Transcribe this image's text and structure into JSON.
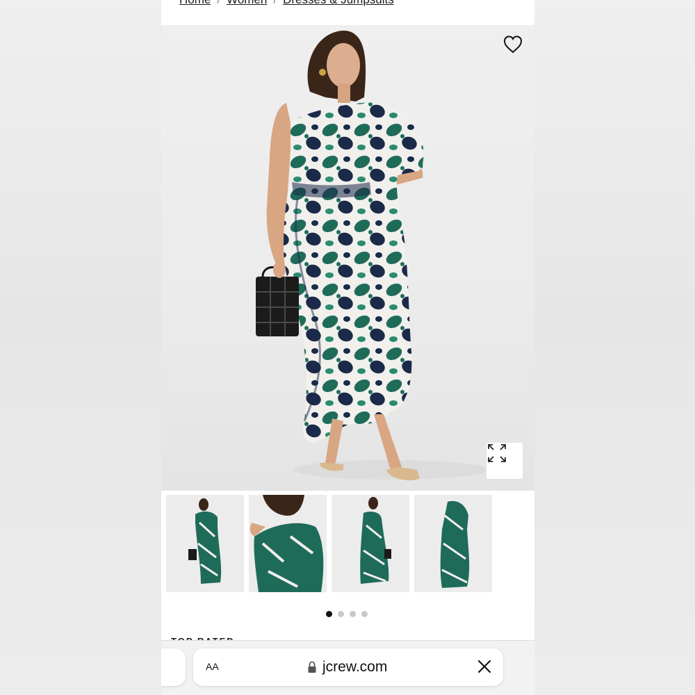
{
  "breadcrumb": {
    "items": [
      "Home",
      "Women",
      "Dresses & Jumpsuits"
    ],
    "separator": "/"
  },
  "product": {
    "dress_colors": {
      "green": "#1f6b5a",
      "navy": "#1c2a4a",
      "ivory": "#f1f0ec"
    }
  },
  "gallery": {
    "thumbnail_count": 4,
    "active_thumbnail": 1,
    "page_indicator_count": 4,
    "active_page": 1
  },
  "section": {
    "label": "TOP RATED"
  },
  "browser": {
    "text_size_label": "AA",
    "url": "jcrew.com",
    "lock_icon": "lock-icon",
    "close_icon": "close-icon"
  },
  "icons": {
    "wishlist": "heart-icon",
    "expand": "expand-icon"
  }
}
